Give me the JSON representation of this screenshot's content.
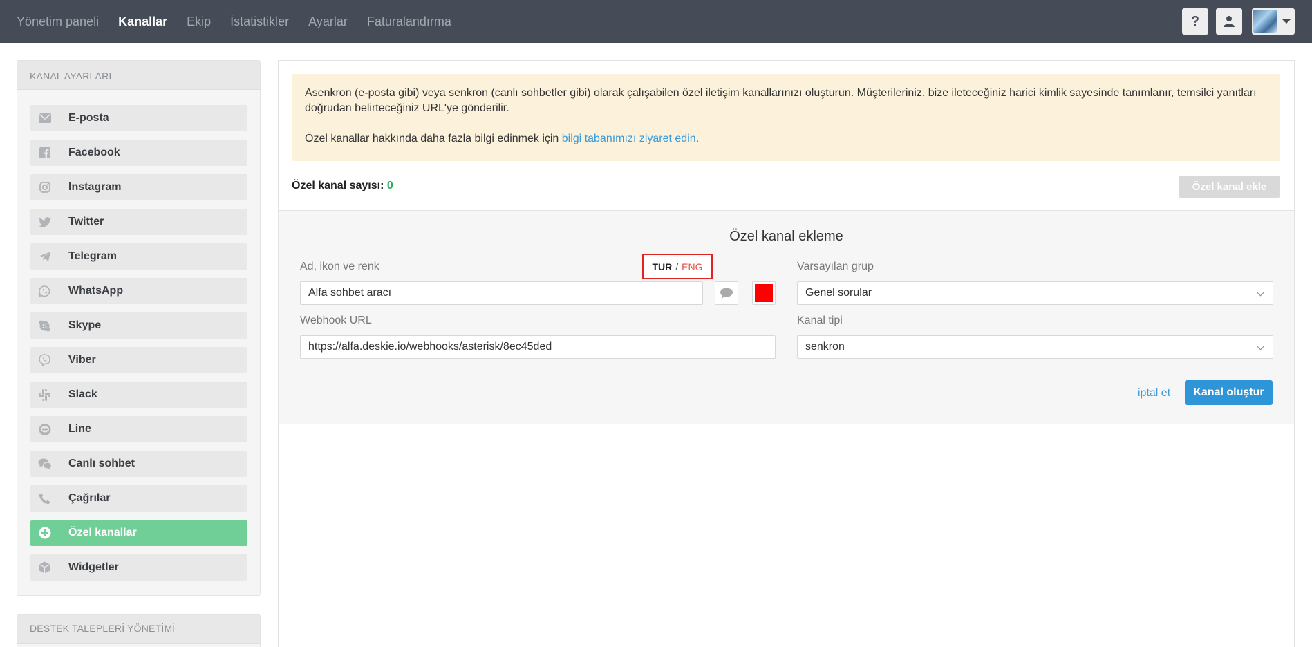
{
  "nav": {
    "items": [
      {
        "label": "Yönetim paneli",
        "active": false
      },
      {
        "label": "Kanallar",
        "active": true
      },
      {
        "label": "Ekip",
        "active": false
      },
      {
        "label": "İstatistikler",
        "active": false
      },
      {
        "label": "Ayarlar",
        "active": false
      },
      {
        "label": "Faturalandırma",
        "active": false
      }
    ],
    "help_label": "?",
    "icons": {
      "help": "question-icon",
      "user": "user-icon",
      "avatar": "avatar-image",
      "dropdown": "caret-down-icon"
    }
  },
  "sidebar": {
    "title": "KANAL AYARLARI",
    "items": [
      {
        "label": "E-posta",
        "icon": "envelope-icon"
      },
      {
        "label": "Facebook",
        "icon": "facebook-icon"
      },
      {
        "label": "Instagram",
        "icon": "instagram-icon"
      },
      {
        "label": "Twitter",
        "icon": "twitter-icon"
      },
      {
        "label": "Telegram",
        "icon": "telegram-icon"
      },
      {
        "label": "WhatsApp",
        "icon": "whatsapp-icon"
      },
      {
        "label": "Skype",
        "icon": "skype-icon"
      },
      {
        "label": "Viber",
        "icon": "viber-icon"
      },
      {
        "label": "Slack",
        "icon": "slack-icon"
      },
      {
        "label": "Line",
        "icon": "line-icon"
      },
      {
        "label": "Canlı sohbet",
        "icon": "chat-bubbles-icon"
      },
      {
        "label": "Çağrılar",
        "icon": "phone-icon"
      },
      {
        "label": "Özel kanallar",
        "icon": "plus-circle-icon",
        "active": true
      },
      {
        "label": "Widgetler",
        "icon": "cube-icon"
      }
    ],
    "section2_title": "DESTEK TALEPLERİ YÖNETİMİ"
  },
  "notice": {
    "line1": "Asenkron (e-posta gibi) veya senkron (canlı sohbetler gibi) olarak çalışabilen özel iletişim kanallarınızı oluşturun. Müşterileriniz, bize ileteceğiniz harici kimlik sayesinde tanımlanır, temsilci yanıtları doğrudan belirteceğiniz URL'ye gönderilir.",
    "line2_prefix": "Özel kanallar hakkında daha fazla bilgi edinmek için ",
    "link": "bilgi tabanımızı ziyaret edin",
    "line2_suffix": "."
  },
  "count": {
    "label": "Özel kanal sayısı:",
    "value": "0"
  },
  "add_button": "Özel kanal ekle",
  "form": {
    "title": "Özel kanal ekleme",
    "name_label": "Ad, ikon ve renk",
    "lang": {
      "tur": "TUR",
      "sep": "/",
      "eng": "ENG"
    },
    "name_value": "Alfa sohbet aracı",
    "channel_icon": "chat-bubble-icon",
    "color": "#ff0000",
    "webhook_label": "Webhook URL",
    "webhook_value": "https://alfa.deskie.io/webhooks/asterisk/8ec45ded",
    "group_label": "Varsayılan grup",
    "group_value": "Genel sorular",
    "type_label": "Kanal tipi",
    "type_value": "senkron",
    "cancel": "iptal et",
    "submit": "Kanal oluştur"
  },
  "colors": {
    "active": "#6fcf97",
    "accent": "#2f95d9",
    "topbar": "#454c57",
    "notice": "#fcf2dc"
  }
}
